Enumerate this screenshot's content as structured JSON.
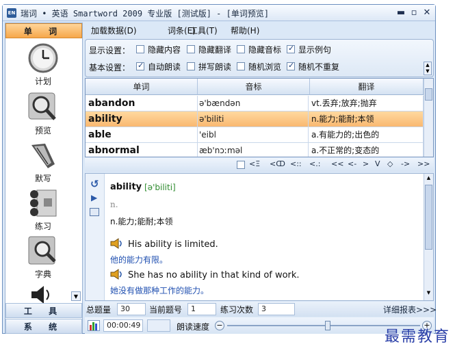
{
  "window": {
    "title": "瑞词 • 英语 Smartword 2009 专业版 [测试版] - [单词预览]",
    "app_icon_text": "EN"
  },
  "sidebar": {
    "tabs": {
      "words": "单 词",
      "tools": "工 具",
      "system": "系 统"
    },
    "items": [
      {
        "label": "计划",
        "icon": "clock-icon"
      },
      {
        "label": "预览",
        "icon": "magnifier-icon"
      },
      {
        "label": "默写",
        "icon": "pen-icon"
      },
      {
        "label": "练习",
        "icon": "practice-icon"
      },
      {
        "label": "字典",
        "icon": "dictionary-icon"
      }
    ]
  },
  "menu": {
    "load": "加载数据(D)",
    "lexicon": "词条(E)",
    "tools": "工具(T)",
    "help": "帮助(H)"
  },
  "settings": {
    "display_label": "显示设置：",
    "basic_label": "基本设置：",
    "display": [
      {
        "label": "隐藏内容",
        "checked": false
      },
      {
        "label": "隐藏翻译",
        "checked": false
      },
      {
        "label": "隐藏音标",
        "checked": false
      },
      {
        "label": "显示例句",
        "checked": true
      }
    ],
    "basic": [
      {
        "label": "自动朗读",
        "checked": true
      },
      {
        "label": "拼写朗读",
        "checked": false
      },
      {
        "label": "随机浏览",
        "checked": false
      },
      {
        "label": "随机不重复",
        "checked": true
      }
    ]
  },
  "table": {
    "headers": [
      "单词",
      "音标",
      "翻译"
    ],
    "rows": [
      {
        "word": "abandon",
        "phonetic": "ə'bændən",
        "translation": "vt.丢弃;放弃;抛弃"
      },
      {
        "word": "ability",
        "phonetic": "ə'biliti",
        "translation": "n.能力;能耐;本领"
      },
      {
        "word": "able",
        "phonetic": "'eibl",
        "translation": "a.有能力的;出色的"
      },
      {
        "word": "abnormal",
        "phonetic": "æb'nɔːməl",
        "translation": "a.不正常的;变态的"
      }
    ],
    "selected_index": 1
  },
  "nav_toolbar": {
    "buttons": [
      "<Ξ",
      "<ↀ",
      "<::",
      "<.:",
      "<<",
      "<-",
      ">",
      "V",
      "◇",
      "->",
      ">>"
    ]
  },
  "detail": {
    "word": "ability",
    "phonetic": "[ə'biliti]",
    "pos": "n.",
    "definition": "n.能力;能耐;本领",
    "examples": [
      {
        "en": "His ability is limited.",
        "cn": "他的能力有限。"
      },
      {
        "en": "She has no ability in that kind of work.",
        "cn": "她没有做那种工作的能力。"
      }
    ]
  },
  "status": {
    "total_label": "总题量",
    "total_value": "30",
    "current_label": "当前题号",
    "current_value": "1",
    "count_label": "练习次数",
    "count_value": "3",
    "report_link": "详细报表>>>"
  },
  "bottom": {
    "timer": "00:00:49",
    "speed_label": "朗读速度",
    "speed_level": 0.52
  },
  "watermark": "最需教育",
  "colors": {
    "selection": "#f9b870",
    "accent": "#2e5c9a",
    "link_blue": "#1f4fb0"
  }
}
